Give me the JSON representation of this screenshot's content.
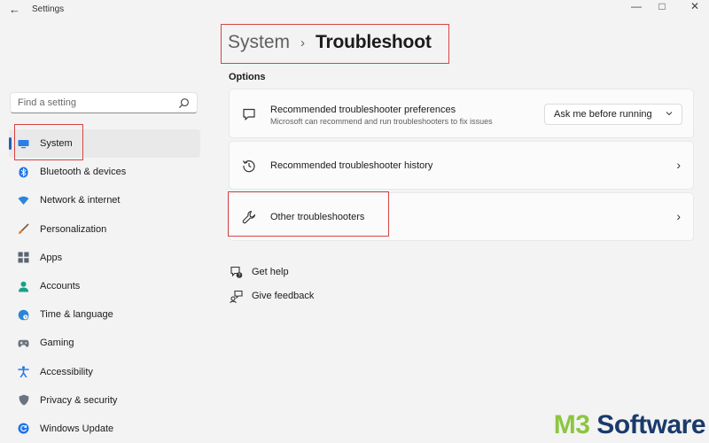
{
  "window": {
    "title": "Settings",
    "back_glyph": "←",
    "minimize_glyph": "—",
    "maximize_glyph": "□",
    "close_glyph": "✕"
  },
  "search": {
    "placeholder": "Find a setting",
    "icon": "search-icon"
  },
  "sidebar": {
    "items": [
      {
        "label": "System",
        "icon": "system-monitor-icon",
        "color": "#2b7de9",
        "active": true
      },
      {
        "label": "Bluetooth & devices",
        "icon": "bluetooth-icon",
        "color": "#1e74e8"
      },
      {
        "label": "Network & internet",
        "icon": "wifi-icon",
        "color": "#2a85d8"
      },
      {
        "label": "Personalization",
        "icon": "brush-icon",
        "color": "#e07a2c"
      },
      {
        "label": "Apps",
        "icon": "apps-icon",
        "color": "#5b6470"
      },
      {
        "label": "Accounts",
        "icon": "person-icon",
        "color": "#18a08a"
      },
      {
        "label": "Time & language",
        "icon": "globe-clock-icon",
        "color": "#2a85d8"
      },
      {
        "label": "Gaming",
        "icon": "gamepad-icon",
        "color": "#6b7380"
      },
      {
        "label": "Accessibility",
        "icon": "accessibility-icon",
        "color": "#1e74e8"
      },
      {
        "label": "Privacy & security",
        "icon": "shield-icon",
        "color": "#6b7380"
      },
      {
        "label": "Windows Update",
        "icon": "update-icon",
        "color": "#1e74e8"
      }
    ]
  },
  "breadcrumb": {
    "parent": "System",
    "separator": "›",
    "current": "Troubleshoot"
  },
  "main": {
    "section_title": "Options",
    "cards": [
      {
        "title": "Recommended troubleshooter preferences",
        "subtitle": "Microsoft can recommend and run troubleshooters to fix issues",
        "icon": "message-icon",
        "dropdown_value": "Ask me before running"
      },
      {
        "title": "Recommended troubleshooter history",
        "icon": "history-icon",
        "chevron": "›"
      },
      {
        "title": "Other troubleshooters",
        "icon": "wrench-icon",
        "chevron": "›"
      }
    ]
  },
  "links": [
    {
      "label": "Get help",
      "icon": "help-chat-icon"
    },
    {
      "label": "Give feedback",
      "icon": "feedback-icon"
    }
  ],
  "watermark": {
    "part1": "M3",
    "part2": " Software"
  },
  "colors": {
    "highlight": "#d64545",
    "accent": "#1f5fbf",
    "watermark_green": "#8cc63f",
    "watermark_navy": "#1a3a6b"
  }
}
